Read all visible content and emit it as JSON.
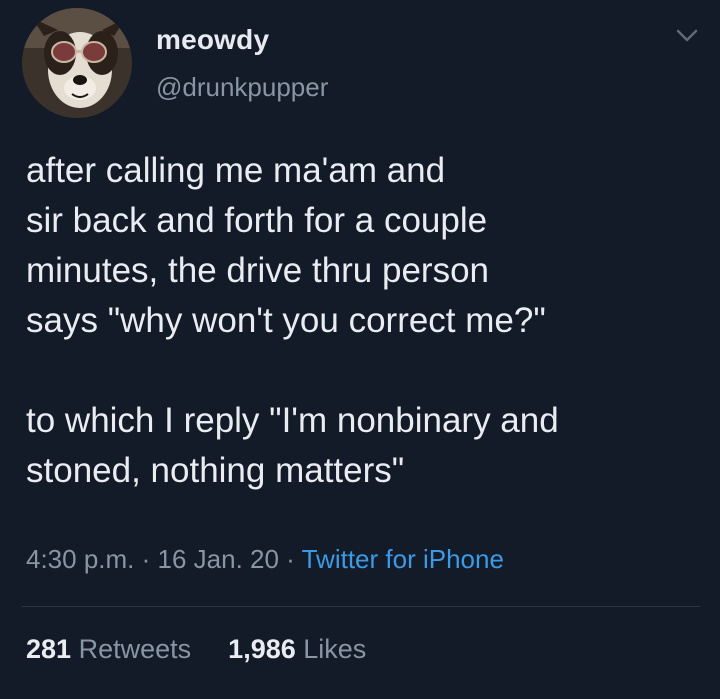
{
  "user": {
    "display_name": "meowdy",
    "handle": "@drunkpupper",
    "avatar_icon": "dog-with-sunglasses-avatar"
  },
  "menu": {
    "icon": "chevron-down-icon"
  },
  "tweet": {
    "text": "after calling me ma'am and\nsir back and forth for a couple\nminutes, the drive thru person\nsays \"why won't you correct me?\"\n\nto which I reply \"I'm nonbinary and\nstoned, nothing matters\""
  },
  "meta": {
    "time": "4:30 p.m.",
    "separator": " · ",
    "date": "16 Jan. 20",
    "source": "Twitter for iPhone"
  },
  "stats": {
    "retweets_count": "281",
    "retweets_label": "Retweets",
    "likes_count": "1,986",
    "likes_label": "Likes"
  },
  "colors": {
    "background": "#141b28",
    "text_primary": "#e9edf2",
    "text_secondary": "#8895a3",
    "link": "#3b9ae6"
  }
}
